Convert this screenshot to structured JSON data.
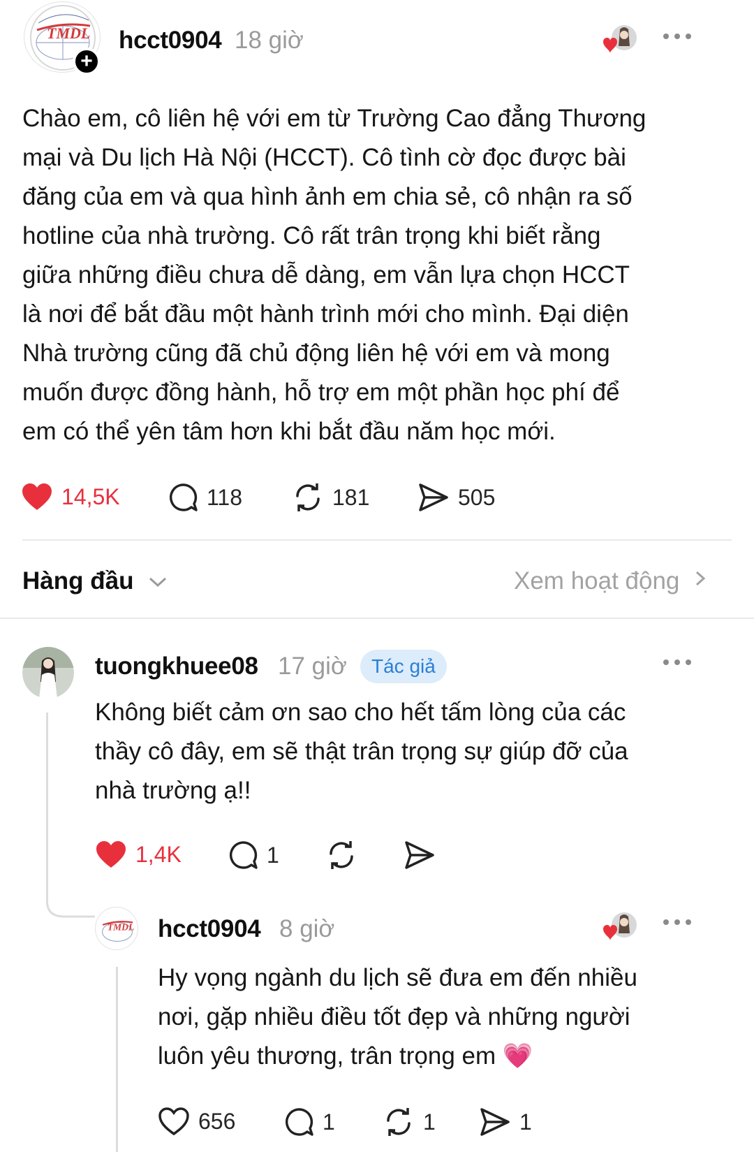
{
  "post": {
    "avatar": {
      "icon": "tmdl-logo-icon",
      "logo_text": "TMDL"
    },
    "username": "hcct0904",
    "time": "18 giờ",
    "text_lines": [
      "Chào em, cô liên hệ với em từ Trường Cao đẳng Thương",
      "mại và Du lịch Hà Nội (HCCT). Cô tình cờ đọc được bài",
      "đăng của em và qua hình ảnh em chia sẻ, cô nhận ra số",
      "hotline của nhà trường. Cô rất trân trọng khi biết rằng",
      "giữa những điều chưa dễ dàng, em vẫn lựa chọn HCCT",
      "là nơi để bắt đầu một hành trình mới cho mình. Đại diện",
      "Nhà trường cũng đã chủ động liên hệ với em và mong",
      "muốn được đồng hành, hỗ trợ em một phần học phí để",
      "em có thể yên tâm hơn khi bắt đầu năm học mới."
    ],
    "likes": "14,5K",
    "replies": "118",
    "reposts": "181",
    "shares": "505"
  },
  "sort": {
    "label": "Hàng đầu",
    "activity_link": "Xem hoạt động"
  },
  "comment": {
    "username": "tuongkhuee08",
    "time": "17 giờ",
    "author_badge": "Tác giả",
    "text_lines": [
      "Không biết cảm ơn sao cho hết tấm lòng của các",
      "thầy cô đây, em sẽ thật trân trọng sự giúp đỡ của",
      "nhà trường ạ!!"
    ],
    "likes": "1,4K",
    "replies": "1"
  },
  "reply": {
    "username": "hcct0904",
    "time": "8 giờ",
    "text_lines": [
      "Hy vọng ngành du lịch sẽ đưa em đến nhiều",
      "nơi, gặp nhiều điều tốt đẹp và những người",
      "luôn yêu thương, trân trọng em"
    ],
    "emoji": "💗",
    "likes": "656",
    "replies": "1",
    "reposts": "1",
    "shares": "1"
  },
  "colors": {
    "like_red": "#e8303d",
    "badge_bg": "#dcecfb",
    "badge_text": "#2a7fd4"
  }
}
